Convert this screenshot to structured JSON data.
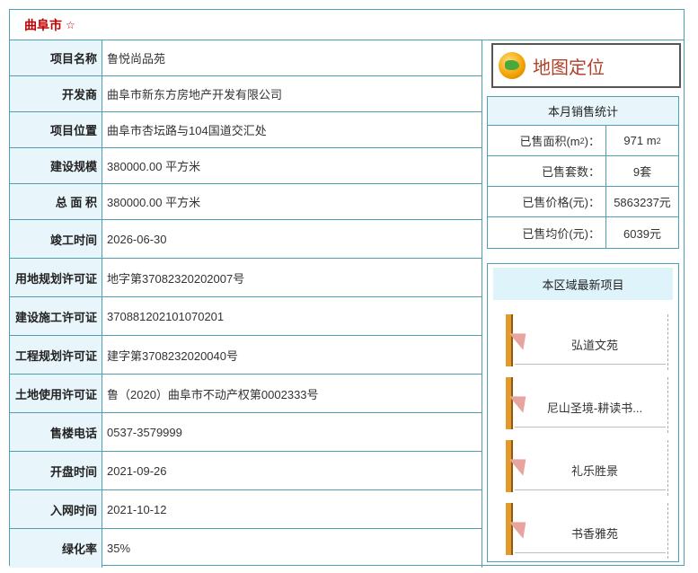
{
  "header": {
    "city": "曲阜市",
    "star": "☆"
  },
  "details": [
    {
      "label": "项目名称",
      "value": "鲁悦尚品苑"
    },
    {
      "label": "开发商",
      "value": "曲阜市新东方房地产开发有限公司"
    },
    {
      "label": "项目位置",
      "value": "曲阜市杏坛路与104国道交汇处"
    },
    {
      "label": "建设规模",
      "value": "380000.00 平方米"
    },
    {
      "label": "总 面 积",
      "value": "380000.00 平方米"
    },
    {
      "label": "竣工时间",
      "value": "2026-06-30"
    },
    {
      "label": "用地规划许可证",
      "value": "地字第37082320202007号"
    },
    {
      "label": "建设施工许可证",
      "value": "370881202101070201"
    },
    {
      "label": "工程规划许可证",
      "value": "建字第3708232020040号"
    },
    {
      "label": "土地使用许可证",
      "value": "鲁（2020）曲阜市不动产权第0002333号"
    },
    {
      "label": "售楼电话",
      "value": "0537-3579999"
    },
    {
      "label": "开盘时间",
      "value": "2021-09-26"
    },
    {
      "label": "入网时间",
      "value": "2021-10-12"
    },
    {
      "label": "绿化率",
      "value": "35%"
    }
  ],
  "map_button": {
    "label": "地图定位",
    "icon": "globe-icon"
  },
  "sales": {
    "title": "本月销售统计",
    "area_label_pre": "已售面积(m",
    "area_label_post": ")：",
    "area_value": "971 m",
    "sup": "2",
    "count_label": "已售套数：",
    "count_value": "9套",
    "price_label": "已售价格(元)：",
    "price_value": "5863237元",
    "avg_label": "已售均价(元)：",
    "avg_value": "6039元"
  },
  "latest": {
    "title": "本区域最新项目",
    "projects": [
      "弘道文苑",
      "尼山圣境-耕读书...",
      "礼乐胜景",
      "书香雅苑"
    ]
  }
}
